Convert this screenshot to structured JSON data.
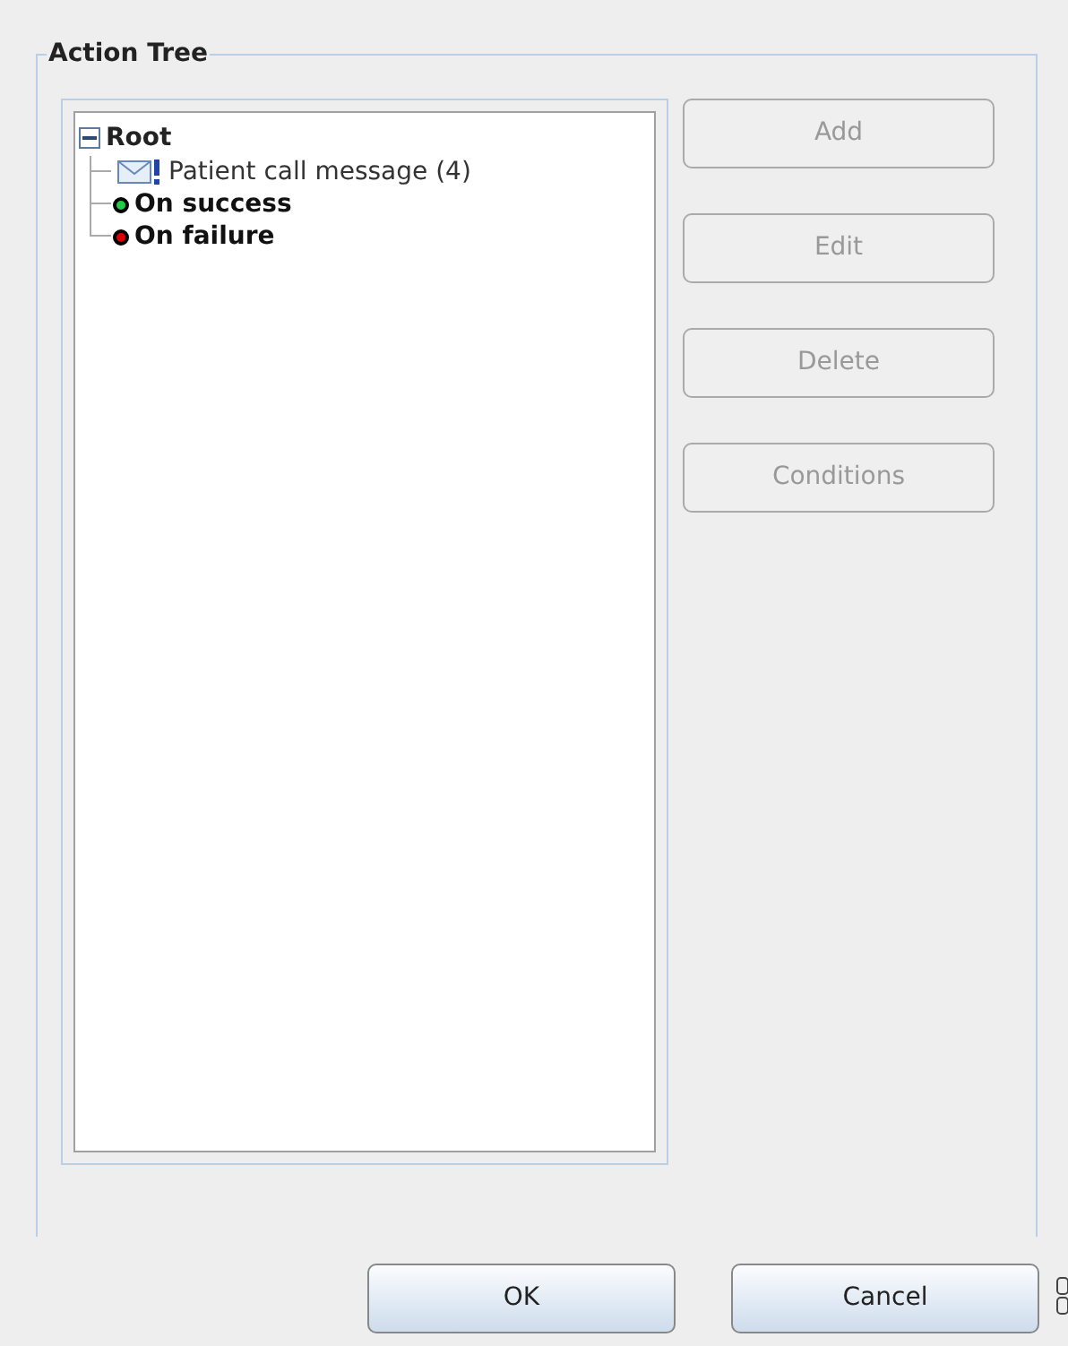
{
  "group": {
    "title": "Action Tree"
  },
  "tree": {
    "label": "Root",
    "expanded": true,
    "children": [
      {
        "kind": "message",
        "label": "Patient call message (4)"
      },
      {
        "kind": "status",
        "label": "On success",
        "color": "#22cc44"
      },
      {
        "kind": "status",
        "label": "On failure",
        "color": "#dd0000"
      }
    ]
  },
  "side_buttons": [
    {
      "label": "Add",
      "disabled": true
    },
    {
      "label": "Edit",
      "disabled": true
    },
    {
      "label": "Delete",
      "disabled": true
    },
    {
      "label": "Conditions",
      "disabled": true
    }
  ],
  "buttons": [
    "OK",
    "Cancel"
  ]
}
